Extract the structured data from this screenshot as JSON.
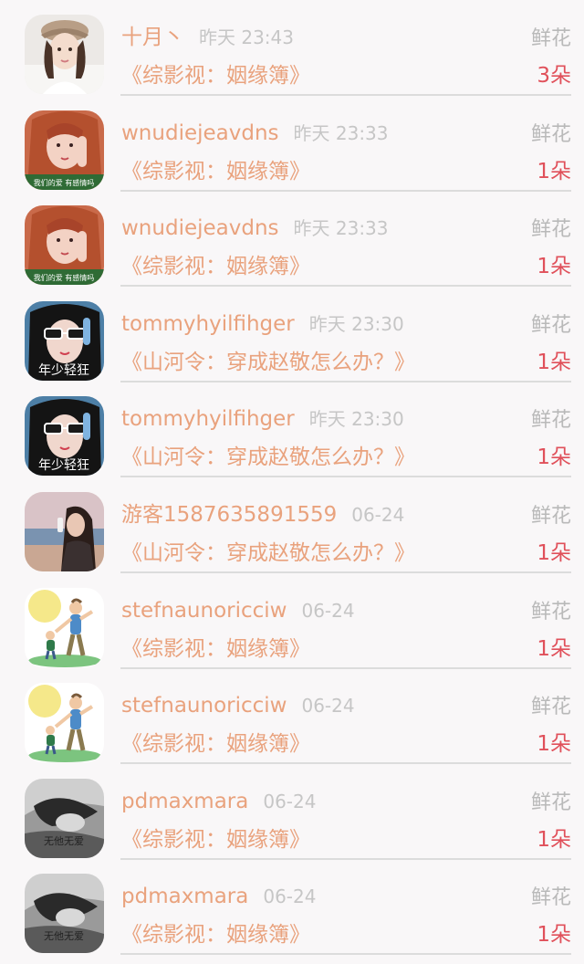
{
  "gift_label": "鲜花",
  "entries": [
    {
      "name": "十月丶",
      "time": "昨天 23:43",
      "book": "《综影视：姻缘簿》",
      "count": "3朵",
      "avatar": "girl-cap-avatar"
    },
    {
      "name": "wnudiejeavdns",
      "time": "昨天 23:33",
      "book": "《综影视：姻缘簿》",
      "count": "1朵",
      "avatar": "red-hair-girl-avatar"
    },
    {
      "name": "wnudiejeavdns",
      "time": "昨天 23:33",
      "book": "《综影视：姻缘簿》",
      "count": "1朵",
      "avatar": "red-hair-girl-avatar"
    },
    {
      "name": "tommyhyilfihger",
      "time": "昨天 23:30",
      "book": "《山河令：穿成赵敬怎么办？》",
      "count": "1朵",
      "avatar": "sunglasses-girl-avatar"
    },
    {
      "name": "tommyhyilfihger",
      "time": "昨天 23:30",
      "book": "《山河令：穿成赵敬怎么办？》",
      "count": "1朵",
      "avatar": "sunglasses-girl-avatar"
    },
    {
      "name": "游客1587635891559",
      "time": "06-24",
      "book": "《山河令：穿成赵敬怎么办？》",
      "count": "1朵",
      "avatar": "seaside-girl-avatar"
    },
    {
      "name": "stefnaunoricciw",
      "time": "06-24",
      "book": "《综影视：姻缘簿》",
      "count": "1朵",
      "avatar": "cartoon-father-child-avatar"
    },
    {
      "name": "stefnaunoricciw",
      "time": "06-24",
      "book": "《综影视：姻缘簿》",
      "count": "1朵",
      "avatar": "cartoon-father-child-avatar"
    },
    {
      "name": "pdmaxmara",
      "time": "06-24",
      "book": "《综影视：姻缘簿》",
      "count": "1朵",
      "avatar": "grayscale-sleeping-avatar"
    },
    {
      "name": "pdmaxmara",
      "time": "06-24",
      "book": "《综影视：姻缘簿》",
      "count": "1朵",
      "avatar": "grayscale-sleeping-avatar"
    }
  ],
  "avatar_captions": {
    "red-hair-girl-avatar": "我们的爱 有感情吗",
    "sunglasses-girl-avatar": "年少轻狂",
    "grayscale-sleeping-avatar": "无他无爱"
  }
}
